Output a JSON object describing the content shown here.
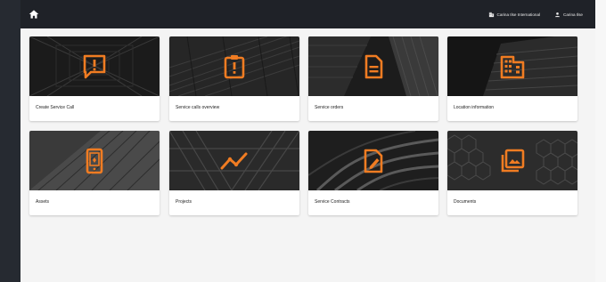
{
  "header": {
    "company_label": "Carina Ilse International",
    "user_label": "Carina Ilse"
  },
  "colors": {
    "accent": "#f07c22",
    "topbar": "#1f2228",
    "rail": "#262a31",
    "background": "#f4f4f4"
  },
  "tiles": [
    {
      "label": "Create Service Call",
      "icon": "alert-message-icon"
    },
    {
      "label": "Service calls overview",
      "icon": "alert-clipboard-icon"
    },
    {
      "label": "Service orders",
      "icon": "document-icon"
    },
    {
      "label": "Location information",
      "icon": "building-icon"
    },
    {
      "label": "Assets",
      "icon": "device-icon"
    },
    {
      "label": "Projects",
      "icon": "trend-line-icon"
    },
    {
      "label": "Service Contracts",
      "icon": "contract-edit-icon"
    },
    {
      "label": "Documents",
      "icon": "images-icon"
    }
  ]
}
